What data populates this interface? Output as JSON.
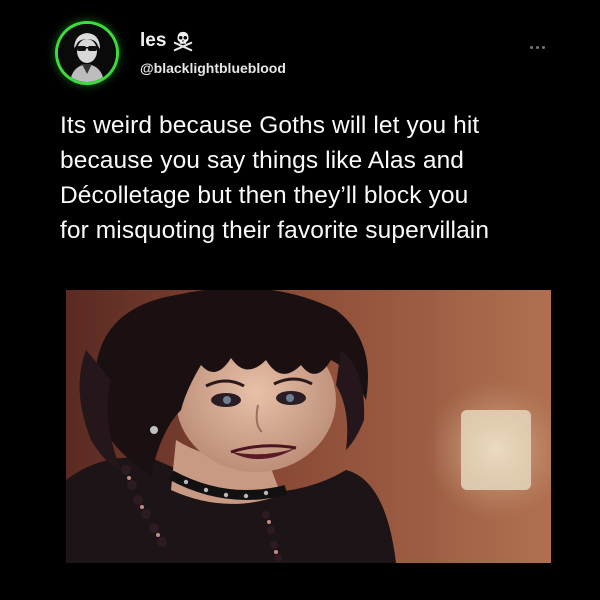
{
  "post": {
    "author": {
      "display_name": "les",
      "badge_icon": "skull-crossbones-icon",
      "handle": "@blacklightblueblood",
      "avatar_ring_color": "#3bdc3b"
    },
    "menu_icon": "more-icon",
    "text_lines": [
      "Its weird because Goths will let you hit",
      "because you say things like Alas and",
      "Décolletage but then they’ll block you",
      "for misquoting their favorite supervillain"
    ],
    "media": {
      "type": "photo",
      "subject": "smiling woman with dark tousled hair, choker and beaded necklaces"
    }
  },
  "colors": {
    "background": "#000000",
    "text": "#fafafa",
    "accent": "#3bdc3b"
  }
}
